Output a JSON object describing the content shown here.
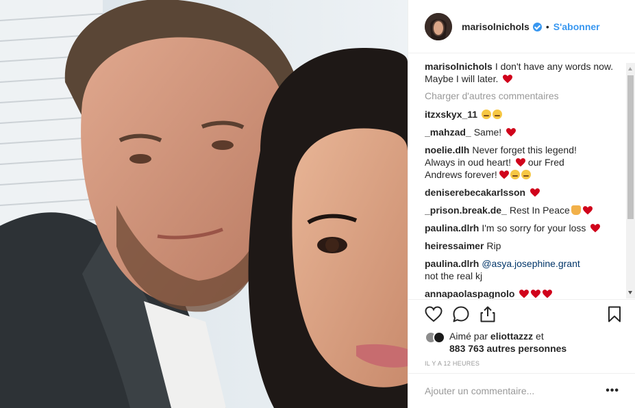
{
  "header": {
    "username": "marisolnichols",
    "separator": "•",
    "follow_label": "S'abonner"
  },
  "caption": {
    "username": "marisolnichols",
    "text": "I don't have any words now. Maybe I will later."
  },
  "load_more_label": "Charger d'autres commentaires",
  "comments": [
    {
      "username": "itzxskyx_11",
      "text": ""
    },
    {
      "username": "_mahzad_",
      "text": "Same!"
    },
    {
      "username": "noelie.dlh",
      "text": "Never forget this legend! Always in oud heart!",
      "text2": "our Fred Andrews forever!"
    },
    {
      "username": "deniserebecakarlsson",
      "text": ""
    },
    {
      "username": "_prison.break.de_",
      "text": "Rest In Peace"
    },
    {
      "username": "paulina.dlrh",
      "text": "I'm so sorry for your loss"
    },
    {
      "username": "heiressaimer",
      "text": "Rip"
    },
    {
      "username": "paulina.dlrh",
      "mention": "@asya.josephine.grant",
      "text": "not the real kj"
    },
    {
      "username": "annapaolaspagnolo",
      "text": ""
    }
  ],
  "likes": {
    "prefix": "Aimé par",
    "user": "eliottazzz",
    "suffix": "et",
    "count": "883 763 autres personnes"
  },
  "timestamp": "Il y a 12 heures",
  "add_comment_placeholder": "Ajouter un commentaire...",
  "more_menu": "•••",
  "colors": {
    "accent": "#3897f0",
    "heart": "#d0021b",
    "muted": "#999999"
  }
}
